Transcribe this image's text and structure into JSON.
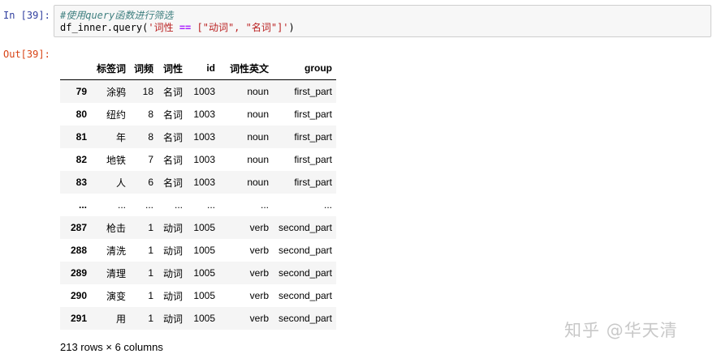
{
  "cell": {
    "in_prompt": "In  [39]:",
    "out_prompt": "Out[39]:",
    "code_comment": "#使用query函数进行筛选",
    "code_prefix": "df_inner.query(",
    "code_str1": "'词性 ",
    "code_op": "==",
    "code_str2": " [\"动词\", \"名词\"]'",
    "code_suffix": ")"
  },
  "table": {
    "headers": [
      "",
      "标签词",
      "词频",
      "词性",
      "id",
      "词性英文",
      "group"
    ],
    "rows": [
      [
        "79",
        "涂鸦",
        "18",
        "名词",
        "1003",
        "noun",
        "first_part"
      ],
      [
        "80",
        "纽约",
        "8",
        "名词",
        "1003",
        "noun",
        "first_part"
      ],
      [
        "81",
        "年",
        "8",
        "名词",
        "1003",
        "noun",
        "first_part"
      ],
      [
        "82",
        "地铁",
        "7",
        "名词",
        "1003",
        "noun",
        "first_part"
      ],
      [
        "83",
        "人",
        "6",
        "名词",
        "1003",
        "noun",
        "first_part"
      ],
      [
        "...",
        "...",
        "...",
        "...",
        "...",
        "...",
        "..."
      ],
      [
        "287",
        "枪击",
        "1",
        "动词",
        "1005",
        "verb",
        "second_part"
      ],
      [
        "288",
        "清洗",
        "1",
        "动词",
        "1005",
        "verb",
        "second_part"
      ],
      [
        "289",
        "清理",
        "1",
        "动词",
        "1005",
        "verb",
        "second_part"
      ],
      [
        "290",
        "演变",
        "1",
        "动词",
        "1005",
        "verb",
        "second_part"
      ],
      [
        "291",
        "用",
        "1",
        "动词",
        "1005",
        "verb",
        "second_part"
      ]
    ]
  },
  "summary": "213 rows × 6 columns",
  "watermark": "知乎 @华天清"
}
